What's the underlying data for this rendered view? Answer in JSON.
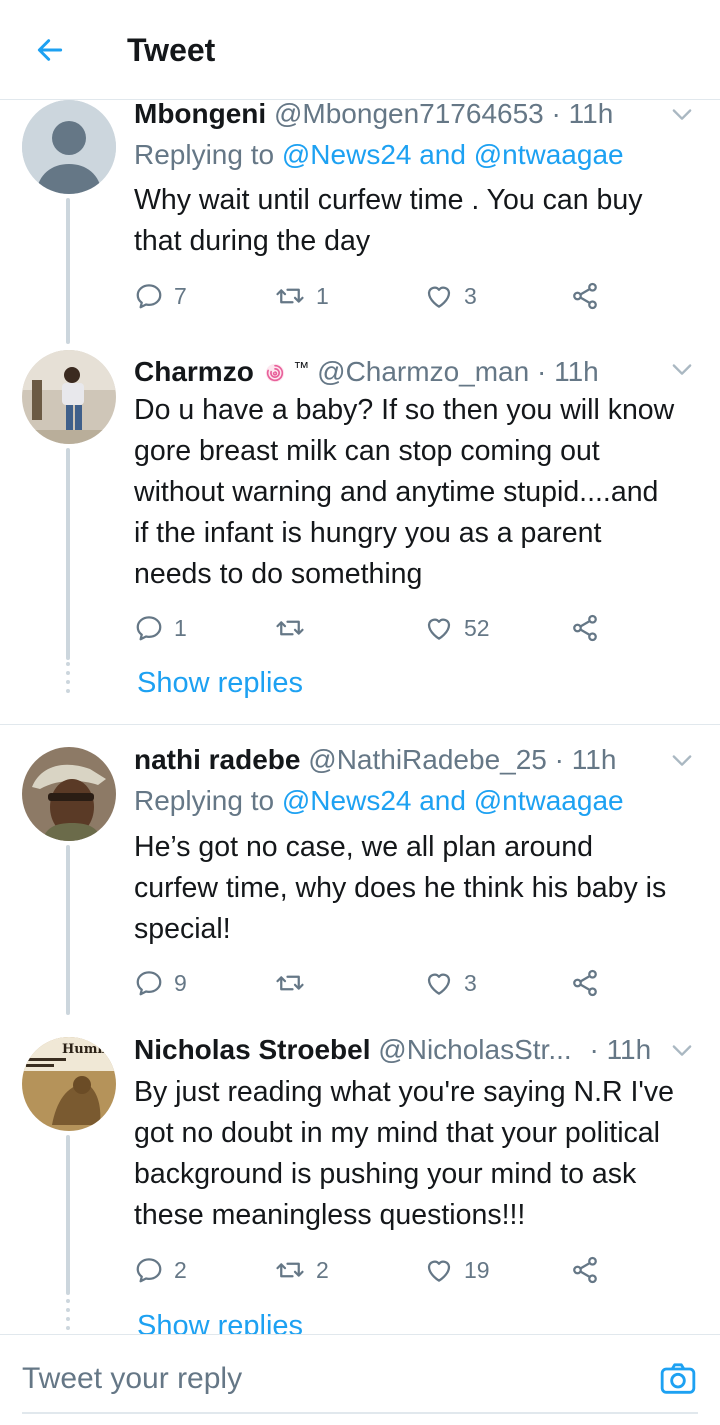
{
  "header": {
    "title": "Tweet"
  },
  "tweets": [
    {
      "name": "Mbongeni",
      "handle": "@Mbongen71764653",
      "sep": "·",
      "time": "11h",
      "replying_prefix": "Replying to ",
      "replying_mentions": "@News24 and @ntwaagae",
      "text_lines": [
        "Why wait until curfew time . You can buy",
        "that during the day"
      ],
      "replies": "7",
      "retweets": "1",
      "likes": "3"
    },
    {
      "name": "Charmzo",
      "badge": "™",
      "handle": "@Charmzo_man",
      "sep": "·",
      "time": "11h",
      "text_lines": [
        "Do u have a baby? If so then you will know",
        "gore breast milk can stop coming out",
        "without warning and anytime stupid....and",
        "if the infant is hungry you as a parent",
        "needs to do something"
      ],
      "replies": "1",
      "retweets": "",
      "likes": "52",
      "show_replies": "Show replies"
    },
    {
      "name": "nathi radebe",
      "handle": "@NathiRadebe_25",
      "sep": "·",
      "time": "11h",
      "replying_prefix": "Replying to ",
      "replying_mentions": "@News24 and @ntwaagae",
      "text_lines": [
        "He’s got no case, we all plan around",
        "curfew time, why does he think his baby is",
        "special!"
      ],
      "replies": "9",
      "retweets": "",
      "likes": "3"
    },
    {
      "name": "Nicholas Stroebel",
      "handle": "@NicholasStr...",
      "sep": "·",
      "time": "11h",
      "text_lines": [
        "By just reading what you're saying N.R I've",
        "got no doubt in my mind that your political",
        "background is pushing your mind to ask",
        "these meaningless questions!!!"
      ],
      "replies": "2",
      "retweets": "2",
      "likes": "19",
      "show_replies": "Show replies",
      "avatar_text": "Humb"
    }
  ],
  "composer": {
    "placeholder": "Tweet your reply"
  },
  "colors": {
    "accent": "#1da1f2",
    "muted": "#657786",
    "text": "#14171a",
    "divider": "#e1e8ed"
  },
  "icons": [
    "back-arrow-icon",
    "chevron-down-icon",
    "reply-icon",
    "retweet-icon",
    "like-icon",
    "share-icon",
    "camera-icon"
  ]
}
